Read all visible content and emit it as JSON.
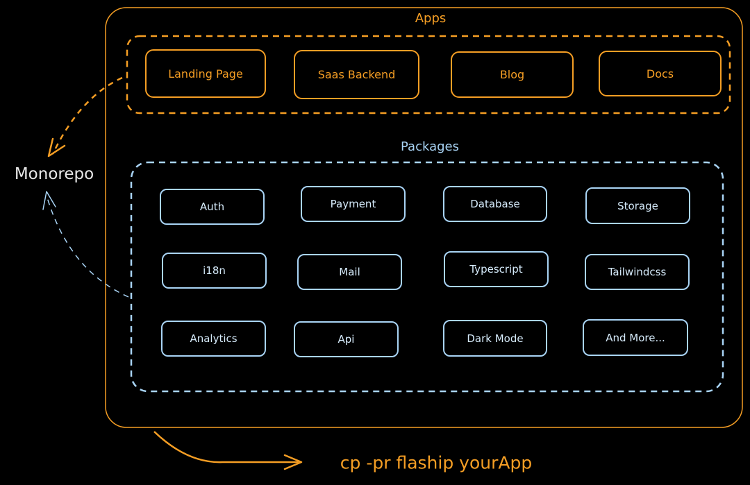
{
  "colors": {
    "apps": "#f59e24",
    "packages": "#a9d4f5",
    "text_light": "#e8e8e8",
    "background": "#000000"
  },
  "diagram": {
    "apps_title": "Apps",
    "packages_title": "Packages",
    "monorepo_label": "Monorepo",
    "command_label": "cp -pr flaship yourApp",
    "apps": [
      {
        "label": "Landing Page"
      },
      {
        "label": "Saas Backend"
      },
      {
        "label": "Blog"
      },
      {
        "label": "Docs"
      }
    ],
    "packages": [
      {
        "label": "Auth"
      },
      {
        "label": "Payment"
      },
      {
        "label": "Database"
      },
      {
        "label": "Storage"
      },
      {
        "label": "i18n"
      },
      {
        "label": "Mail"
      },
      {
        "label": "Typescript"
      },
      {
        "label": "Tailwindcss"
      },
      {
        "label": "Analytics"
      },
      {
        "label": "Api"
      },
      {
        "label": "Dark Mode"
      },
      {
        "label": "And More..."
      }
    ]
  }
}
